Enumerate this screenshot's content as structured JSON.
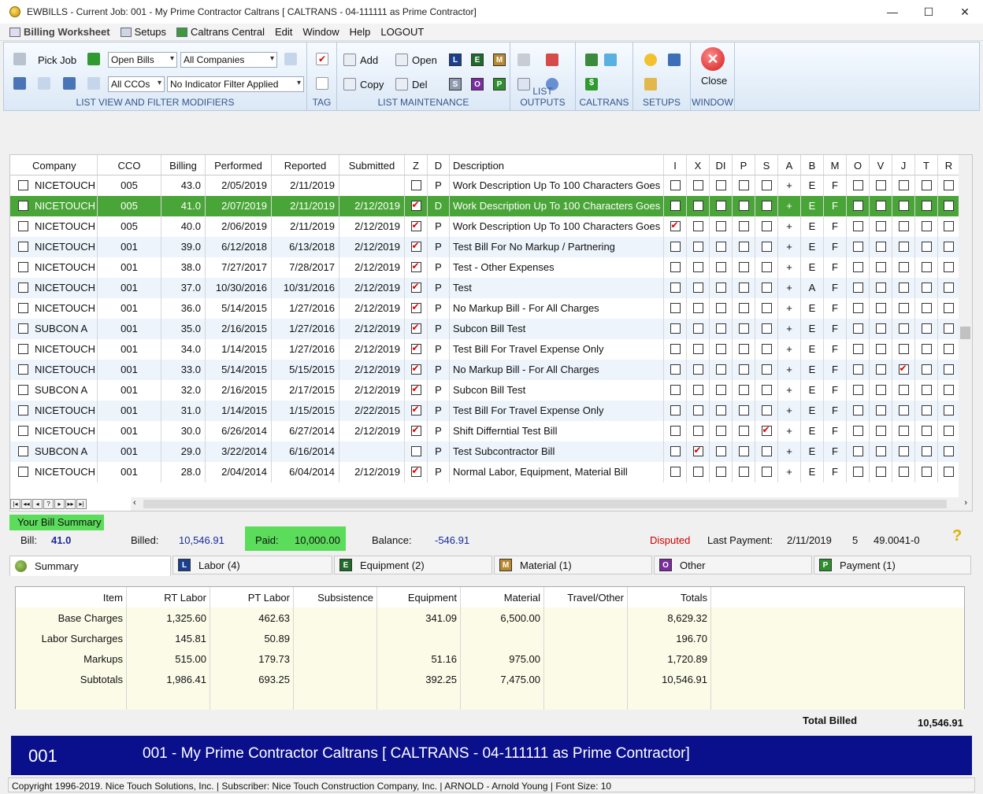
{
  "window": {
    "title": "EWBILLS - Current Job: 001 - My Prime Contractor Caltrans  [ CALTRANS - 04-111111 as Prime Contractor]",
    "minimize": "—",
    "maximize": "☐",
    "close": "✕"
  },
  "menu": {
    "items": [
      "Billing Worksheet",
      "Setups",
      "Caltrans Central",
      "Edit",
      "Window",
      "Help",
      "LOGOUT"
    ]
  },
  "ribbon": {
    "pick_job": "Pick Job",
    "open_bills": "Open Bills",
    "all_companies": "All Companies",
    "all_ccos": "All CCOs",
    "indicator_filter": "No Indicator Filter Applied",
    "add": "Add",
    "open": "Open",
    "copy": "Copy",
    "del": "Del",
    "close": "Close",
    "letters_top": [
      "L",
      "E",
      "M"
    ],
    "letters_bottom": [
      "S",
      "O",
      "P"
    ],
    "groups": {
      "list_view": "LIST VIEW AND FILTER MODIFIERS",
      "tag": "TAG",
      "list_maint": "LIST MAINTENANCE",
      "list_outputs": "LIST OUTPUTS",
      "caltrans": "CALTRANS",
      "setups": "SETUPS",
      "window": "WINDOW"
    }
  },
  "grid": {
    "headers": [
      "Company",
      "CCO",
      "Billing",
      "Performed",
      "Reported",
      "Submitted",
      "Z",
      "D",
      "Description",
      "I",
      "X",
      "DI",
      "P",
      "S",
      "A",
      "B",
      "M",
      "O",
      "V",
      "J",
      "T",
      "R"
    ],
    "rows": [
      {
        "company": "NICETOUCH",
        "cco": "005",
        "billing": "43.0",
        "performed": "2/05/2019",
        "reported": "2/11/2019",
        "submitted": "",
        "z": false,
        "d": "P",
        "desc": "Work Description Up To 100 Characters Goes",
        "i": false,
        "x": false,
        "di": false,
        "p": false,
        "s": false,
        "a": "+",
        "b": "E",
        "m": "F",
        "o": false,
        "v": false,
        "j": false,
        "t": false,
        "r": false
      },
      {
        "company": "NICETOUCH",
        "cco": "005",
        "billing": "41.0",
        "performed": "2/07/2019",
        "reported": "2/11/2019",
        "submitted": "2/12/2019",
        "z": true,
        "d": "D",
        "desc": "Work Description Up To 100 Characters Goes",
        "i": false,
        "x": false,
        "di": false,
        "p": false,
        "s": false,
        "a": "+",
        "b": "E",
        "m": "F",
        "o": false,
        "v": false,
        "j": false,
        "t": false,
        "r": false
      },
      {
        "company": "NICETOUCH",
        "cco": "005",
        "billing": "40.0",
        "performed": "2/06/2019",
        "reported": "2/11/2019",
        "submitted": "2/12/2019",
        "z": true,
        "d": "P",
        "desc": "Work Description Up To 100 Characters Goes",
        "i": true,
        "x": false,
        "di": false,
        "p": false,
        "s": false,
        "a": "+",
        "b": "E",
        "m": "F",
        "o": false,
        "v": false,
        "j": false,
        "t": false,
        "r": false
      },
      {
        "company": "NICETOUCH",
        "cco": "001",
        "billing": "39.0",
        "performed": "6/12/2018",
        "reported": "6/13/2018",
        "submitted": "2/12/2019",
        "z": true,
        "d": "P",
        "desc": "Test Bill For No Markup / Partnering",
        "i": false,
        "x": false,
        "di": false,
        "p": false,
        "s": false,
        "a": "+",
        "b": "E",
        "m": "F",
        "o": false,
        "v": false,
        "j": false,
        "t": false,
        "r": false
      },
      {
        "company": "NICETOUCH",
        "cco": "001",
        "billing": "38.0",
        "performed": "7/27/2017",
        "reported": "7/28/2017",
        "submitted": "2/12/2019",
        "z": true,
        "d": "P",
        "desc": "Test - Other Expenses",
        "i": false,
        "x": false,
        "di": false,
        "p": false,
        "s": false,
        "a": "+",
        "b": "E",
        "m": "F",
        "o": false,
        "v": false,
        "j": false,
        "t": false,
        "r": false
      },
      {
        "company": "NICETOUCH",
        "cco": "001",
        "billing": "37.0",
        "performed": "10/30/2016",
        "reported": "10/31/2016",
        "submitted": "2/12/2019",
        "z": true,
        "d": "P",
        "desc": "Test",
        "i": false,
        "x": false,
        "di": false,
        "p": false,
        "s": false,
        "a": "+",
        "b": "A",
        "m": "F",
        "o": false,
        "v": false,
        "j": false,
        "t": false,
        "r": false
      },
      {
        "company": "NICETOUCH",
        "cco": "001",
        "billing": "36.0",
        "performed": "5/14/2015",
        "reported": "1/27/2016",
        "submitted": "2/12/2019",
        "z": true,
        "d": "P",
        "desc": "No Markup Bill - For All Charges",
        "i": false,
        "x": false,
        "di": false,
        "p": false,
        "s": false,
        "a": "+",
        "b": "E",
        "m": "F",
        "o": false,
        "v": false,
        "j": false,
        "t": false,
        "r": false
      },
      {
        "company": "SUBCON A",
        "cco": "001",
        "billing": "35.0",
        "performed": "2/16/2015",
        "reported": "1/27/2016",
        "submitted": "2/12/2019",
        "z": true,
        "d": "P",
        "desc": "Subcon Bill Test",
        "i": false,
        "x": false,
        "di": false,
        "p": false,
        "s": false,
        "a": "+",
        "b": "E",
        "m": "F",
        "o": false,
        "v": false,
        "j": false,
        "t": false,
        "r": false
      },
      {
        "company": "NICETOUCH",
        "cco": "001",
        "billing": "34.0",
        "performed": "1/14/2015",
        "reported": "1/27/2016",
        "submitted": "2/12/2019",
        "z": true,
        "d": "P",
        "desc": "Test Bill For Travel Expense Only",
        "i": false,
        "x": false,
        "di": false,
        "p": false,
        "s": false,
        "a": "+",
        "b": "E",
        "m": "F",
        "o": false,
        "v": false,
        "j": false,
        "t": false,
        "r": false
      },
      {
        "company": "NICETOUCH",
        "cco": "001",
        "billing": "33.0",
        "performed": "5/14/2015",
        "reported": "5/15/2015",
        "submitted": "2/12/2019",
        "z": true,
        "d": "P",
        "desc": "No Markup Bill - For All Charges",
        "i": false,
        "x": false,
        "di": false,
        "p": false,
        "s": false,
        "a": "+",
        "b": "E",
        "m": "F",
        "o": false,
        "v": false,
        "j": true,
        "t": false,
        "r": false
      },
      {
        "company": "SUBCON A",
        "cco": "001",
        "billing": "32.0",
        "performed": "2/16/2015",
        "reported": "2/17/2015",
        "submitted": "2/12/2019",
        "z": true,
        "d": "P",
        "desc": "Subcon Bill Test",
        "i": false,
        "x": false,
        "di": false,
        "p": false,
        "s": false,
        "a": "+",
        "b": "E",
        "m": "F",
        "o": false,
        "v": false,
        "j": false,
        "t": false,
        "r": false
      },
      {
        "company": "NICETOUCH",
        "cco": "001",
        "billing": "31.0",
        "performed": "1/14/2015",
        "reported": "1/15/2015",
        "submitted": "2/22/2015",
        "z": true,
        "d": "P",
        "desc": "Test Bill For Travel Expense Only",
        "i": false,
        "x": false,
        "di": false,
        "p": false,
        "s": false,
        "a": "+",
        "b": "E",
        "m": "F",
        "o": false,
        "v": false,
        "j": false,
        "t": false,
        "r": false
      },
      {
        "company": "NICETOUCH",
        "cco": "001",
        "billing": "30.0",
        "performed": "6/26/2014",
        "reported": "6/27/2014",
        "submitted": "2/12/2019",
        "z": true,
        "d": "P",
        "desc": "Shift Differntial Test Bill",
        "i": false,
        "x": false,
        "di": false,
        "p": false,
        "s": true,
        "a": "+",
        "b": "E",
        "m": "F",
        "o": false,
        "v": false,
        "j": false,
        "t": false,
        "r": false
      },
      {
        "company": "SUBCON A",
        "cco": "001",
        "billing": "29.0",
        "performed": "3/22/2014",
        "reported": "6/16/2014",
        "submitted": "",
        "z": false,
        "d": "P",
        "desc": "Test Subcontractor Bill",
        "i": false,
        "x": true,
        "di": false,
        "p": false,
        "s": false,
        "a": "+",
        "b": "E",
        "m": "F",
        "o": false,
        "v": false,
        "j": false,
        "t": false,
        "r": false
      },
      {
        "company": "NICETOUCH",
        "cco": "001",
        "billing": "28.0",
        "performed": "2/04/2014",
        "reported": "6/04/2014",
        "submitted": "2/12/2019",
        "z": true,
        "d": "P",
        "desc": "Normal Labor, Equipment, Material Bill",
        "i": false,
        "x": false,
        "di": false,
        "p": false,
        "s": false,
        "a": "+",
        "b": "E",
        "m": "F",
        "o": false,
        "v": false,
        "j": false,
        "t": false,
        "r": false
      }
    ],
    "selected_index": 1
  },
  "summary": {
    "tag": "Your Bill Summary",
    "bill_label": "Bill:",
    "bill_value": "41.0",
    "billed_label": "Billed:",
    "billed_value": "10,546.91",
    "paid_label": "Paid:",
    "paid_value": "10,000.00",
    "balance_label": "Balance:",
    "balance_value": "-546.91",
    "disputed": "Disputed",
    "last_payment_label": "Last Payment:",
    "last_payment_date": "2/11/2019",
    "last_payment_num": "5",
    "last_payment_ref": "49.0041-0",
    "help": "?"
  },
  "tabs": [
    "Summary",
    "Labor (4)",
    "Equipment (2)",
    "Material (1)",
    "Other",
    "Payment (1)"
  ],
  "tab_letters": [
    "",
    "L",
    "E",
    "M",
    "O",
    "P"
  ],
  "charges": {
    "headers": [
      "Item",
      "RT Labor",
      "PT Labor",
      "Subsistence",
      "Equipment",
      "Material",
      "Travel/Other",
      "Totals"
    ],
    "rows": [
      [
        "Base Charges",
        "1,325.60",
        "462.63",
        "",
        "341.09",
        "6,500.00",
        "",
        "8,629.32"
      ],
      [
        "Labor Surcharges",
        "145.81",
        "50.89",
        "",
        "",
        "",
        "",
        "196.70"
      ],
      [
        "Markups",
        "515.00",
        "179.73",
        "",
        "51.16",
        "975.00",
        "",
        "1,720.89"
      ],
      [
        "Subtotals",
        "1,986.41",
        "693.25",
        "",
        "392.25",
        "7,475.00",
        "",
        "10,546.91"
      ],
      [
        "",
        "",
        "",
        "",
        "",
        "",
        "",
        ""
      ]
    ],
    "total_billed_label": "Total Billed",
    "total_billed_value": "10,546.91"
  },
  "job": {
    "number": "001",
    "description": "001 - My Prime Contractor Caltrans  [ CALTRANS - 04-111111 as Prime Contractor]"
  },
  "status": "Copyright 1996-2019. Nice Touch Solutions, Inc.  |  Subscriber: Nice Touch Construction Company, Inc.  |  ARNOLD - Arnold Young | Font Size: 10",
  "colors": {
    "selected_row": "#4aa538",
    "summary_green": "#5bdc5b",
    "job_bar": "#0a0f8c",
    "disputed": "#cc0000",
    "billed_blue": "#1a2a9a"
  }
}
